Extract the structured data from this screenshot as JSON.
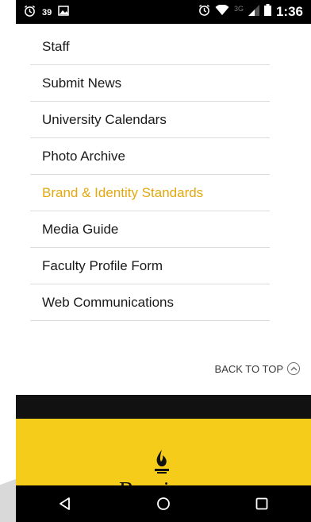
{
  "status_bar": {
    "left_num": "39",
    "network": "3G",
    "time": "1:36"
  },
  "menu": {
    "items": [
      {
        "label": "Staff"
      },
      {
        "label": "Submit News"
      },
      {
        "label": "University Calendars"
      },
      {
        "label": "Photo Archive"
      },
      {
        "label": "Brand & Identity Standards"
      },
      {
        "label": "Media Guide"
      },
      {
        "label": "Faculty Profile Form"
      },
      {
        "label": "Web Communications"
      }
    ],
    "active_index": 4
  },
  "back_to_top": {
    "label": "BACK TO TOP"
  },
  "footer": {
    "wordmark": "Bowie",
    "colors": {
      "black": "#111111",
      "yellow": "#f5cc1a"
    }
  },
  "nav_icons": [
    "back-icon",
    "home-icon",
    "recents-icon"
  ],
  "colors": {
    "accent": "#e2a80f"
  }
}
